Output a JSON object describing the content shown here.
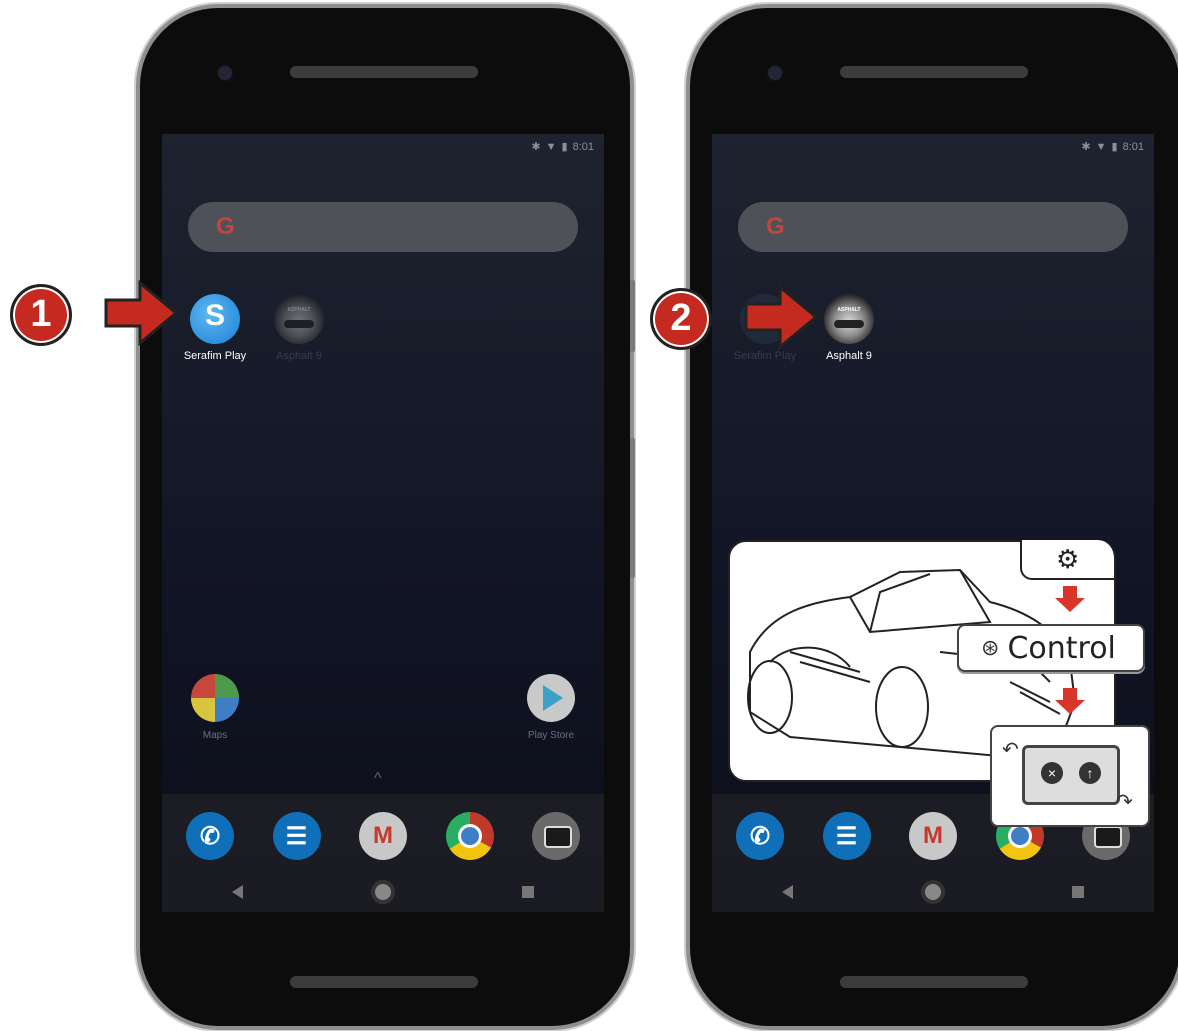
{
  "phone1": {
    "status_time": "8:01",
    "apps": [
      {
        "label": "Serafim Play",
        "glyph": "S"
      },
      {
        "label": "Asphalt 9",
        "badge": "ASPHALT"
      }
    ],
    "dock_apps": [
      {
        "label": "Maps"
      },
      {
        "label": "Play Store"
      }
    ],
    "marker": "1"
  },
  "phone2": {
    "status_time": "8:01",
    "apps": [
      {
        "label": "Serafim Play"
      },
      {
        "label": "Asphalt 9",
        "badge": "ASPHALT"
      }
    ],
    "marker": "2"
  },
  "search": {
    "logo": "G"
  },
  "overlay": {
    "settings_icon": "gear-icon",
    "control_label": "Control",
    "control_icon": "steering-wheel-icon",
    "pad_button_x": "×",
    "pad_button_up": "↑"
  },
  "colors": {
    "accent_red": "#c42a1f",
    "serafim_blue": "#1a80d8"
  }
}
